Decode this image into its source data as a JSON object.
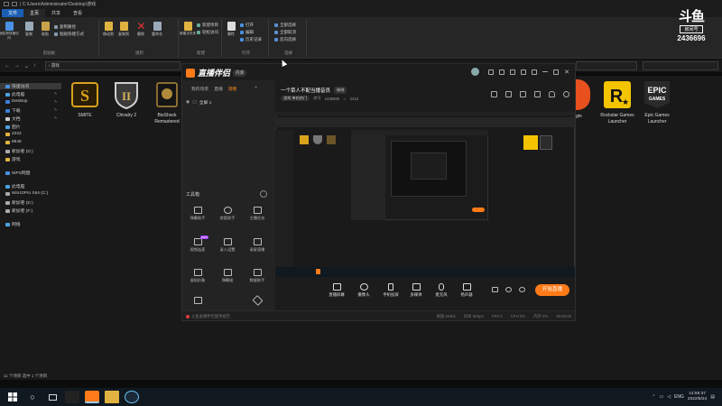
{
  "explorer": {
    "title": "| C:\\Users\\Administrator\\Desktop\\游戏",
    "tabs": [
      "文件",
      "主页",
      "共享",
      "查看"
    ],
    "ribbon": {
      "clipboard_label": "剪贴板",
      "pin_label": "固定到快速访问",
      "copy_label": "复制",
      "paste_label": "粘贴",
      "copy_path": "复制路径",
      "paste_shortcut": "粘贴快捷方式",
      "organize_label": "组织",
      "move_to": "移动到",
      "copy_to": "复制到",
      "delete": "删除",
      "rename": "重命名",
      "new_label": "新建",
      "new_folder": "新建文件夹",
      "new_item": "新建项目",
      "easy_access": "轻松访问",
      "properties": "属性",
      "open": "打开",
      "edit": "编辑",
      "history": "历史记录",
      "open_label": "打开",
      "select_all": "全部选择",
      "select_none": "全部取消",
      "invert": "反向选择",
      "select_label": "选择"
    },
    "address": "› 游戏",
    "nav": [
      "快速访问",
      "此电脑",
      "Desktop",
      "下载",
      "文档",
      "图片",
      "2222",
      "8848",
      "新加卷 (D:)",
      "游戏",
      "WPS网盘",
      "此电脑",
      "Win10Pro X64 (C:)",
      "新加卷 (D:)",
      "新加卷 (F:)",
      "网络"
    ],
    "items": [
      {
        "name": "SMITE"
      },
      {
        "name": "Chivalry 2"
      },
      {
        "name": "BioShock Remastered"
      },
      {
        "name": "Rockstar Games Launcher"
      },
      {
        "name": "Epic Games Launcher"
      }
    ],
    "partial_label": "gin",
    "status": "11 个项目    选中 1 个项目"
  },
  "watermark": {
    "logo": "斗鱼",
    "room_label": "房间号",
    "room_number": "2436696"
  },
  "app": {
    "name": "直播伴侣",
    "version": "内测",
    "left_tabs": [
      "我的场景",
      "直播",
      "观看"
    ],
    "scene": "全屏 1",
    "tools_header": "工具箱",
    "tools": [
      "弹幕助手",
      "房管助手",
      "主播任务",
      "视频连麦",
      "录入设置",
      "录屏直播",
      "虚拟形象",
      "弹幕姬",
      "数据助手"
    ],
    "room_title": "一个菜人不配当播音员",
    "room_edit": "修改",
    "room_tag": "游戏 单机热门",
    "room_id_label": "房号",
    "room_id": "2436696",
    "room_hot": "2415",
    "bottom_tools": [
      "直播屏幕",
      "摄像头",
      "手机投屏",
      "多媒体",
      "麦克风",
      "扬声器"
    ],
    "go_live": "开始直播",
    "status_left": "斗鱼直播伴侣使用规范",
    "status_right": [
      "网速 0KB/s",
      "码率 0Kbps",
      "FPS 0",
      "CPU 0%",
      "内存 0%",
      "00:00:00"
    ]
  },
  "taskbar": {
    "time": "14:55:37",
    "date": "2022/6/24",
    "lang": "ENG"
  },
  "colors": {
    "accent": "#ff7a18",
    "file_tab": "#1a5fb4",
    "smite_gold": "#d8a21a",
    "rockstar_yellow": "#f5c400",
    "epic_bg": "#2a2a2a"
  }
}
